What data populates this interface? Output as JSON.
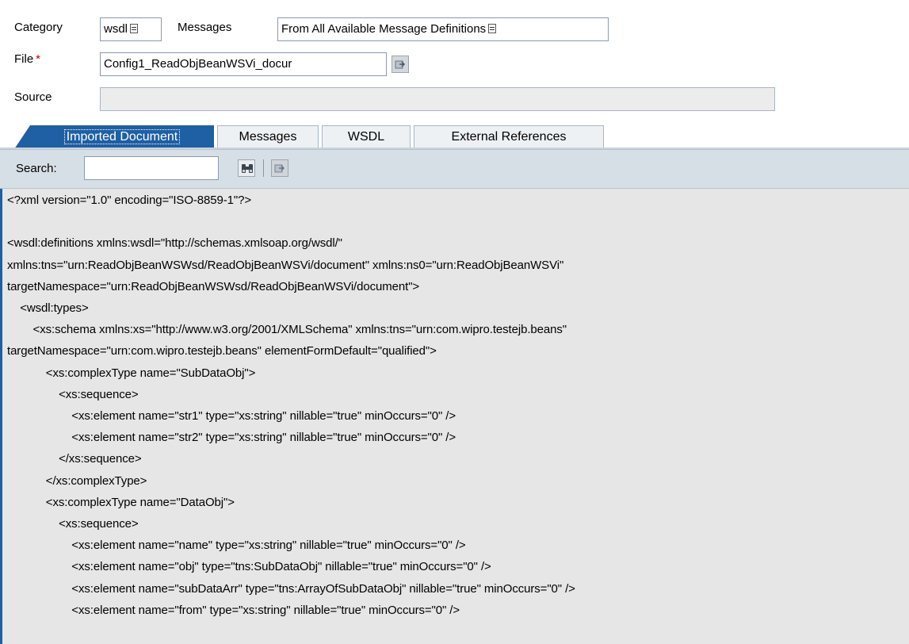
{
  "form": {
    "category_label": "Category",
    "category_value": "wsdl",
    "messages_label": "Messages",
    "messages_value": "From All Available Message Definitions",
    "file_label": "File",
    "file_required_marker": "*",
    "file_value": "Config1_ReadObjBeanWSVi_docur",
    "source_label": "Source",
    "source_value": ""
  },
  "tabs": [
    {
      "label": "Imported Document",
      "active": true
    },
    {
      "label": "Messages"
    },
    {
      "label": "WSDL"
    },
    {
      "label": "External References"
    }
  ],
  "search": {
    "label": "Search:",
    "value": ""
  },
  "document_lines": [
    "<?xml version=\"1.0\" encoding=\"ISO-8859-1\"?>",
    "",
    "<wsdl:definitions xmlns:wsdl=\"http://schemas.xmlsoap.org/wsdl/\"",
    "xmlns:tns=\"urn:ReadObjBeanWSWsd/ReadObjBeanWSVi/document\" xmlns:ns0=\"urn:ReadObjBeanWSVi\"",
    "targetNamespace=\"urn:ReadObjBeanWSWsd/ReadObjBeanWSVi/document\">",
    "    <wsdl:types>",
    "        <xs:schema xmlns:xs=\"http://www.w3.org/2001/XMLSchema\" xmlns:tns=\"urn:com.wipro.testejb.beans\"",
    "targetNamespace=\"urn:com.wipro.testejb.beans\" elementFormDefault=\"qualified\">",
    "            <xs:complexType name=\"SubDataObj\">",
    "                <xs:sequence>",
    "                    <xs:element name=\"str1\" type=\"xs:string\" nillable=\"true\" minOccurs=\"0\" />",
    "                    <xs:element name=\"str2\" type=\"xs:string\" nillable=\"true\" minOccurs=\"0\" />",
    "                </xs:sequence>",
    "            </xs:complexType>",
    "            <xs:complexType name=\"DataObj\">",
    "                <xs:sequence>",
    "                    <xs:element name=\"name\" type=\"xs:string\" nillable=\"true\" minOccurs=\"0\" />",
    "                    <xs:element name=\"obj\" type=\"tns:SubDataObj\" nillable=\"true\" minOccurs=\"0\" />",
    "                    <xs:element name=\"subDataArr\" type=\"tns:ArrayOfSubDataObj\" nillable=\"true\" minOccurs=\"0\" />",
    "                    <xs:element name=\"from\" type=\"xs:string\" nillable=\"true\" minOccurs=\"0\" />"
  ],
  "colors": {
    "accent": "#1f5fa3",
    "toolbar_bg": "#d7dfe6",
    "document_bg": "#e6e6e6",
    "required": "#cc0000"
  },
  "icons": [
    "dropdown-icon",
    "open-file-icon",
    "binoculars-search-icon",
    "next-arrow-icon"
  ]
}
